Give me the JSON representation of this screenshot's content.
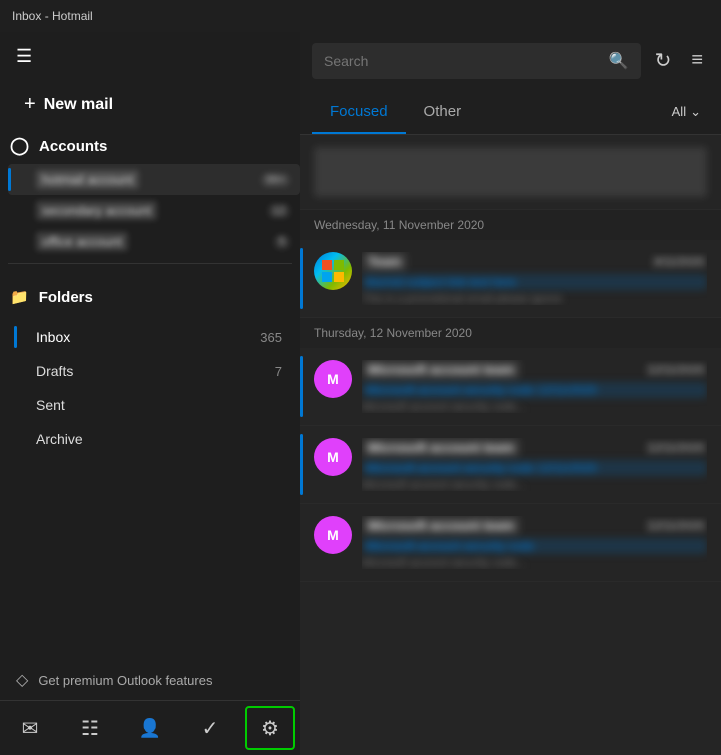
{
  "titleBar": {
    "title": "Inbox - Hotmail"
  },
  "sidebar": {
    "hamburgerLabel": "☰",
    "newMailLabel": "New mail",
    "newMailIcon": "+",
    "sections": {
      "accounts": {
        "label": "Accounts",
        "icon": "person"
      },
      "folders": {
        "label": "Folders",
        "icon": "folder",
        "items": [
          {
            "name": "Inbox",
            "count": "365",
            "active": true
          },
          {
            "name": "Drafts",
            "count": "7",
            "active": false
          },
          {
            "name": "Sent",
            "count": "",
            "active": false
          },
          {
            "name": "Archive",
            "count": "",
            "active": false
          }
        ]
      }
    },
    "premiumLink": "Get premium Outlook features"
  },
  "bottomNav": {
    "items": [
      {
        "icon": "✉",
        "name": "mail-nav",
        "label": "Mail"
      },
      {
        "icon": "⊞",
        "name": "calendar-nav",
        "label": "Calendar"
      },
      {
        "icon": "👤",
        "name": "people-nav",
        "label": "People"
      },
      {
        "icon": "✓",
        "name": "tasks-nav",
        "label": "Tasks"
      },
      {
        "icon": "⚙",
        "name": "settings-nav",
        "label": "Settings",
        "active": true
      }
    ]
  },
  "rightPanel": {
    "searchBar": {
      "placeholder": "Search",
      "searchIcon": "🔍",
      "syncIcon": "↻",
      "filterIcon": "≡"
    },
    "tabs": [
      {
        "label": "Focused",
        "active": true
      },
      {
        "label": "Other",
        "active": false
      }
    ],
    "filterLabel": "All",
    "emails": {
      "groups": [
        {
          "date": "",
          "items": [
            {
              "id": "email-1",
              "avatarType": "blurred",
              "sender": "blurred sender",
              "time": "blurred time",
              "subject": "blurred subject",
              "preview": "blurred preview text",
              "hasAccent": false
            }
          ]
        },
        {
          "date": "Wednesday, 11 November 2020",
          "items": [
            {
              "id": "email-2",
              "avatarType": "windows",
              "sender": "Team",
              "time": "4/11/2020",
              "subject": "blurred subject link",
              "preview": "This is a promotional email please",
              "hasAccent": true
            }
          ]
        },
        {
          "date": "Thursday, 12 November 2020",
          "items": [
            {
              "id": "email-3",
              "avatarType": "msft-pink",
              "sender": "Microsoft account team",
              "time": "12/11/2020",
              "subject": "Microsoft account security code",
              "preview": "Microsoft account security co...",
              "hasAccent": true
            },
            {
              "id": "email-4",
              "avatarType": "msft-pink",
              "sender": "Microsoft account team",
              "time": "12/11/2020",
              "subject": "Microsoft account security code",
              "preview": "Microsoft account security co...",
              "hasAccent": true
            },
            {
              "id": "email-5",
              "avatarType": "msft-pink",
              "sender": "Microsoft account team",
              "time": "12/11/2020",
              "subject": "Microsoft account security code",
              "preview": "Microsoft account security co...",
              "hasAccent": false
            }
          ]
        }
      ]
    }
  }
}
